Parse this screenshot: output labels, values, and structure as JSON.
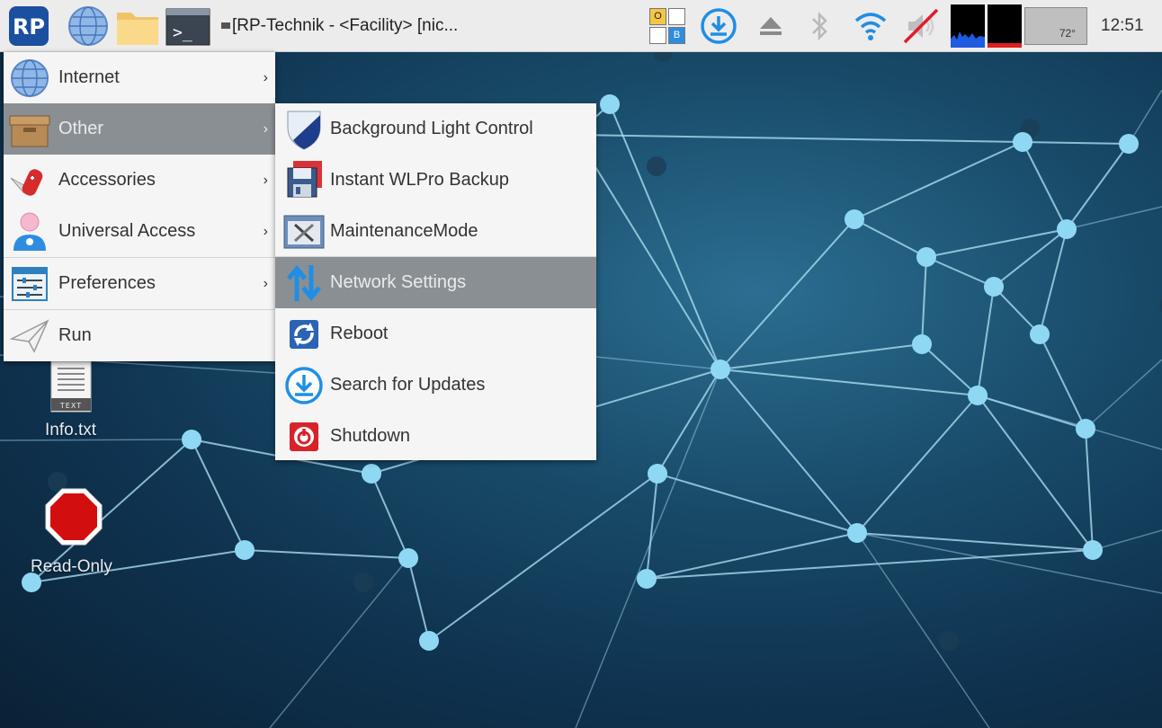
{
  "taskbar": {
    "window_title": "[RP-Technik - <Facility> [nic...",
    "temperature": "72°",
    "clock": "12:51",
    "indicator_o": "O",
    "indicator_b": "B",
    "launchers": [
      "rp-logo-icon",
      "globe-icon",
      "folder-icon",
      "terminal-icon"
    ],
    "tray": [
      "update-download-icon",
      "eject-icon",
      "bluetooth-icon",
      "wifi-icon",
      "volume-muted-icon",
      "cpu-monitor",
      "memory-monitor"
    ]
  },
  "main_menu": {
    "items": [
      {
        "label": "Internet",
        "icon": "globe-icon",
        "has_submenu": true
      },
      {
        "label": "Other",
        "icon": "box-icon",
        "has_submenu": true,
        "selected": true
      },
      {
        "label": "Accessories",
        "icon": "swiss-knife-icon",
        "has_submenu": true
      },
      {
        "label": "Universal Access",
        "icon": "accessibility-person-icon",
        "has_submenu": true
      },
      {
        "label": "Preferences",
        "icon": "sliders-icon",
        "has_submenu": true
      },
      {
        "label": "Run",
        "icon": "paper-plane-icon",
        "has_submenu": false
      }
    ],
    "arrow": "›"
  },
  "sub_menu": {
    "items": [
      {
        "label": "Background Light Control",
        "icon": "shield-icon"
      },
      {
        "label": "Instant WLPro Backup",
        "icon": "floppy-icon"
      },
      {
        "label": "MaintenanceMode",
        "icon": "tools-icon"
      },
      {
        "label": "Network Settings",
        "icon": "up-down-arrows-icon",
        "selected": true
      },
      {
        "label": "Reboot",
        "icon": "reboot-icon"
      },
      {
        "label": "Search for Updates",
        "icon": "download-circle-icon"
      },
      {
        "label": "Shutdown",
        "icon": "power-icon"
      }
    ]
  },
  "desktop": {
    "icons": [
      {
        "label": "Info.txt",
        "icon": "text-file-icon",
        "badge": "TEXT"
      },
      {
        "label": "Read-Only",
        "icon": "stop-sign-icon"
      }
    ]
  },
  "colors": {
    "taskbar_bg": "#ececec",
    "menu_bg": "#f5f5f5",
    "selection": "#8a8f93",
    "node": "#8fd8f3",
    "edge": "#a9dcef"
  }
}
